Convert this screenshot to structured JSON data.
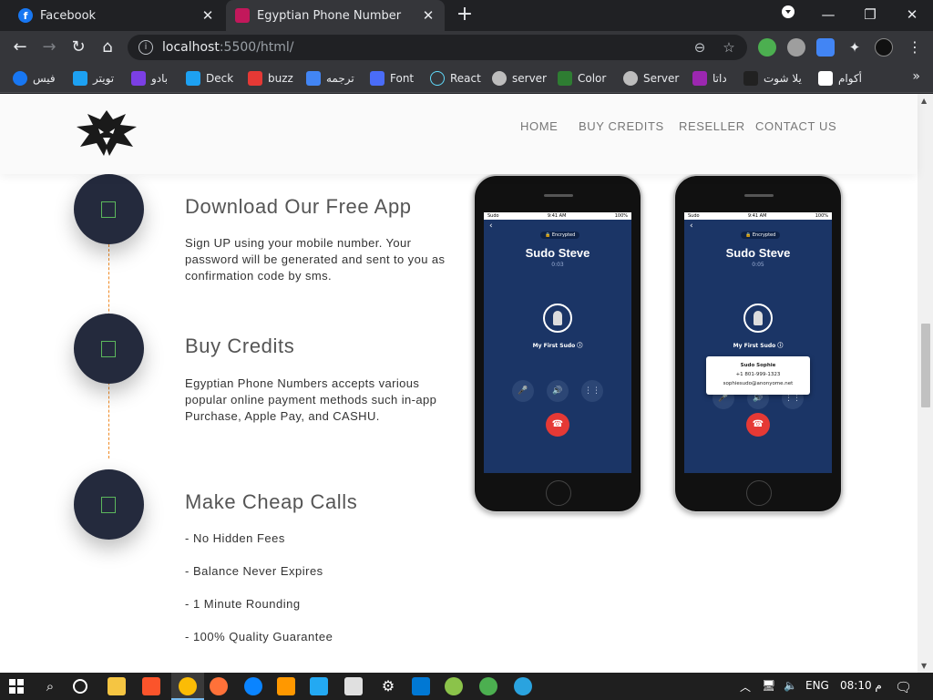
{
  "browser": {
    "tabs": [
      {
        "label": "Facebook",
        "favicon": "facebook-icon"
      },
      {
        "label": "Egyptian Phone Number",
        "favicon": "site-icon"
      }
    ],
    "close_glyph": "✕",
    "new_tab_glyph": "+",
    "url_host": "localhost",
    "url_path": ":5500/html/",
    "bookmarks": [
      {
        "label": "فيس",
        "icon": "facebook-icon",
        "color": "#1877f2"
      },
      {
        "label": "تويتر",
        "icon": "twitter-icon",
        "color": "#1da1f2"
      },
      {
        "label": "بادو",
        "icon": "badoo-icon",
        "color": "#7b3fe4"
      },
      {
        "label": "Deck",
        "icon": "tweetdeck-icon",
        "color": "#1da1f2"
      },
      {
        "label": "buzz",
        "icon": "buzz-icon",
        "color": "#e53935"
      },
      {
        "label": "ترجمه",
        "icon": "translate-icon",
        "color": "#4285f4"
      },
      {
        "label": "Font",
        "icon": "flag-icon",
        "color": "#4a6cf7"
      },
      {
        "label": "React",
        "icon": "react-icon",
        "color": "#61dafb"
      },
      {
        "label": "server",
        "icon": "globe-icon",
        "color": "#bdbdbd"
      },
      {
        "label": "Color",
        "icon": "w-icon",
        "color": "#2e7d32"
      },
      {
        "label": "Server",
        "icon": "globe-icon",
        "color": "#bdbdbd"
      },
      {
        "label": "داتا",
        "icon": "data-icon",
        "color": "#9c27b0"
      },
      {
        "label": "يلا شوت",
        "icon": "yallashoot-icon",
        "color": "#212121"
      },
      {
        "label": "أكوام",
        "icon": "akwam-icon",
        "color": "#ffffff"
      }
    ],
    "more_glyph": "»"
  },
  "site": {
    "nav": [
      "HOME",
      "BUY CREDITS",
      "RESELLER",
      "CONTACT US"
    ],
    "steps": [
      {
        "title": "Download Our Free App",
        "text": "Sign UP using your mobile number. Your password will be generated and sent to you as confirmation code by sms."
      },
      {
        "title": "Buy Credits",
        "text": "Egyptian Phone Numbers accepts various popular online payment methods such in-app Purchase, Apple Pay, and CASHU."
      },
      {
        "title": "Make Cheap Calls",
        "text": ""
      }
    ],
    "bullets": [
      "- No Hidden Fees",
      "- Balance Never Expires",
      "- 1 Minute Rounding",
      "- 100% Quality Guarantee"
    ],
    "phones": [
      {
        "encrypted": "🔒 Encrypted",
        "name": "Sudo Steve",
        "time": "0:03",
        "sudo": "My First Sudo ⓘ",
        "status_left": "Sudo",
        "status_mid": "9:41 AM",
        "status_right": "100%"
      },
      {
        "encrypted": "🔒 Encrypted",
        "name": "Sudo Steve",
        "time": "0:05",
        "sudo": "My First Sudo ⓘ",
        "status_left": "Sudo",
        "status_mid": "9:41 AM",
        "status_right": "100%",
        "popup": {
          "name": "Sudo Sophie",
          "phone": "+1 801-999-1323",
          "email": "sophiesudo@anonyome.net"
        }
      }
    ]
  },
  "taskbar": {
    "lang": "ENG",
    "time": "08:10 م"
  },
  "colors": {
    "accent_orange": "#f08a24",
    "step_circle": "#242a3d",
    "phone_screen": "#1b3566",
    "end_call": "#e53935"
  }
}
